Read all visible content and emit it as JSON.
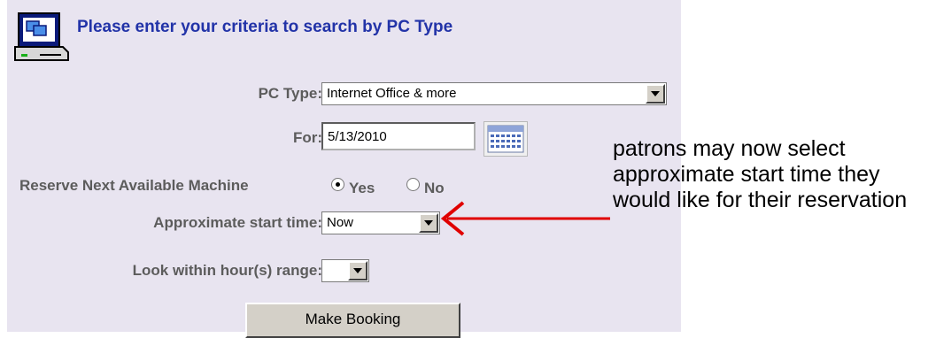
{
  "heading": "Please enter your criteria to search by PC Type",
  "pc_type": {
    "label": "PC Type:",
    "value": "Internet Office & more"
  },
  "for": {
    "label": "For:",
    "value": "5/13/2010"
  },
  "reserve_next": {
    "label": "Reserve Next Available Machine",
    "yes": "Yes",
    "no": "No",
    "selected": "Yes"
  },
  "start_time": {
    "label": "Approximate start time:",
    "value": "Now"
  },
  "hour_range": {
    "label": "Look within hour(s) range:",
    "value": ""
  },
  "make_booking": "Make Booking",
  "annotation": "patrons may now select approximate start time they would like for their reservation",
  "colors": {
    "heading": "#2233a8",
    "label": "#5c5c5c",
    "panel": "#e8e4f0",
    "arrow": "#e00000"
  },
  "icons": [
    "computer-icon",
    "calendar-icon",
    "dropdown-arrow-icon"
  ]
}
